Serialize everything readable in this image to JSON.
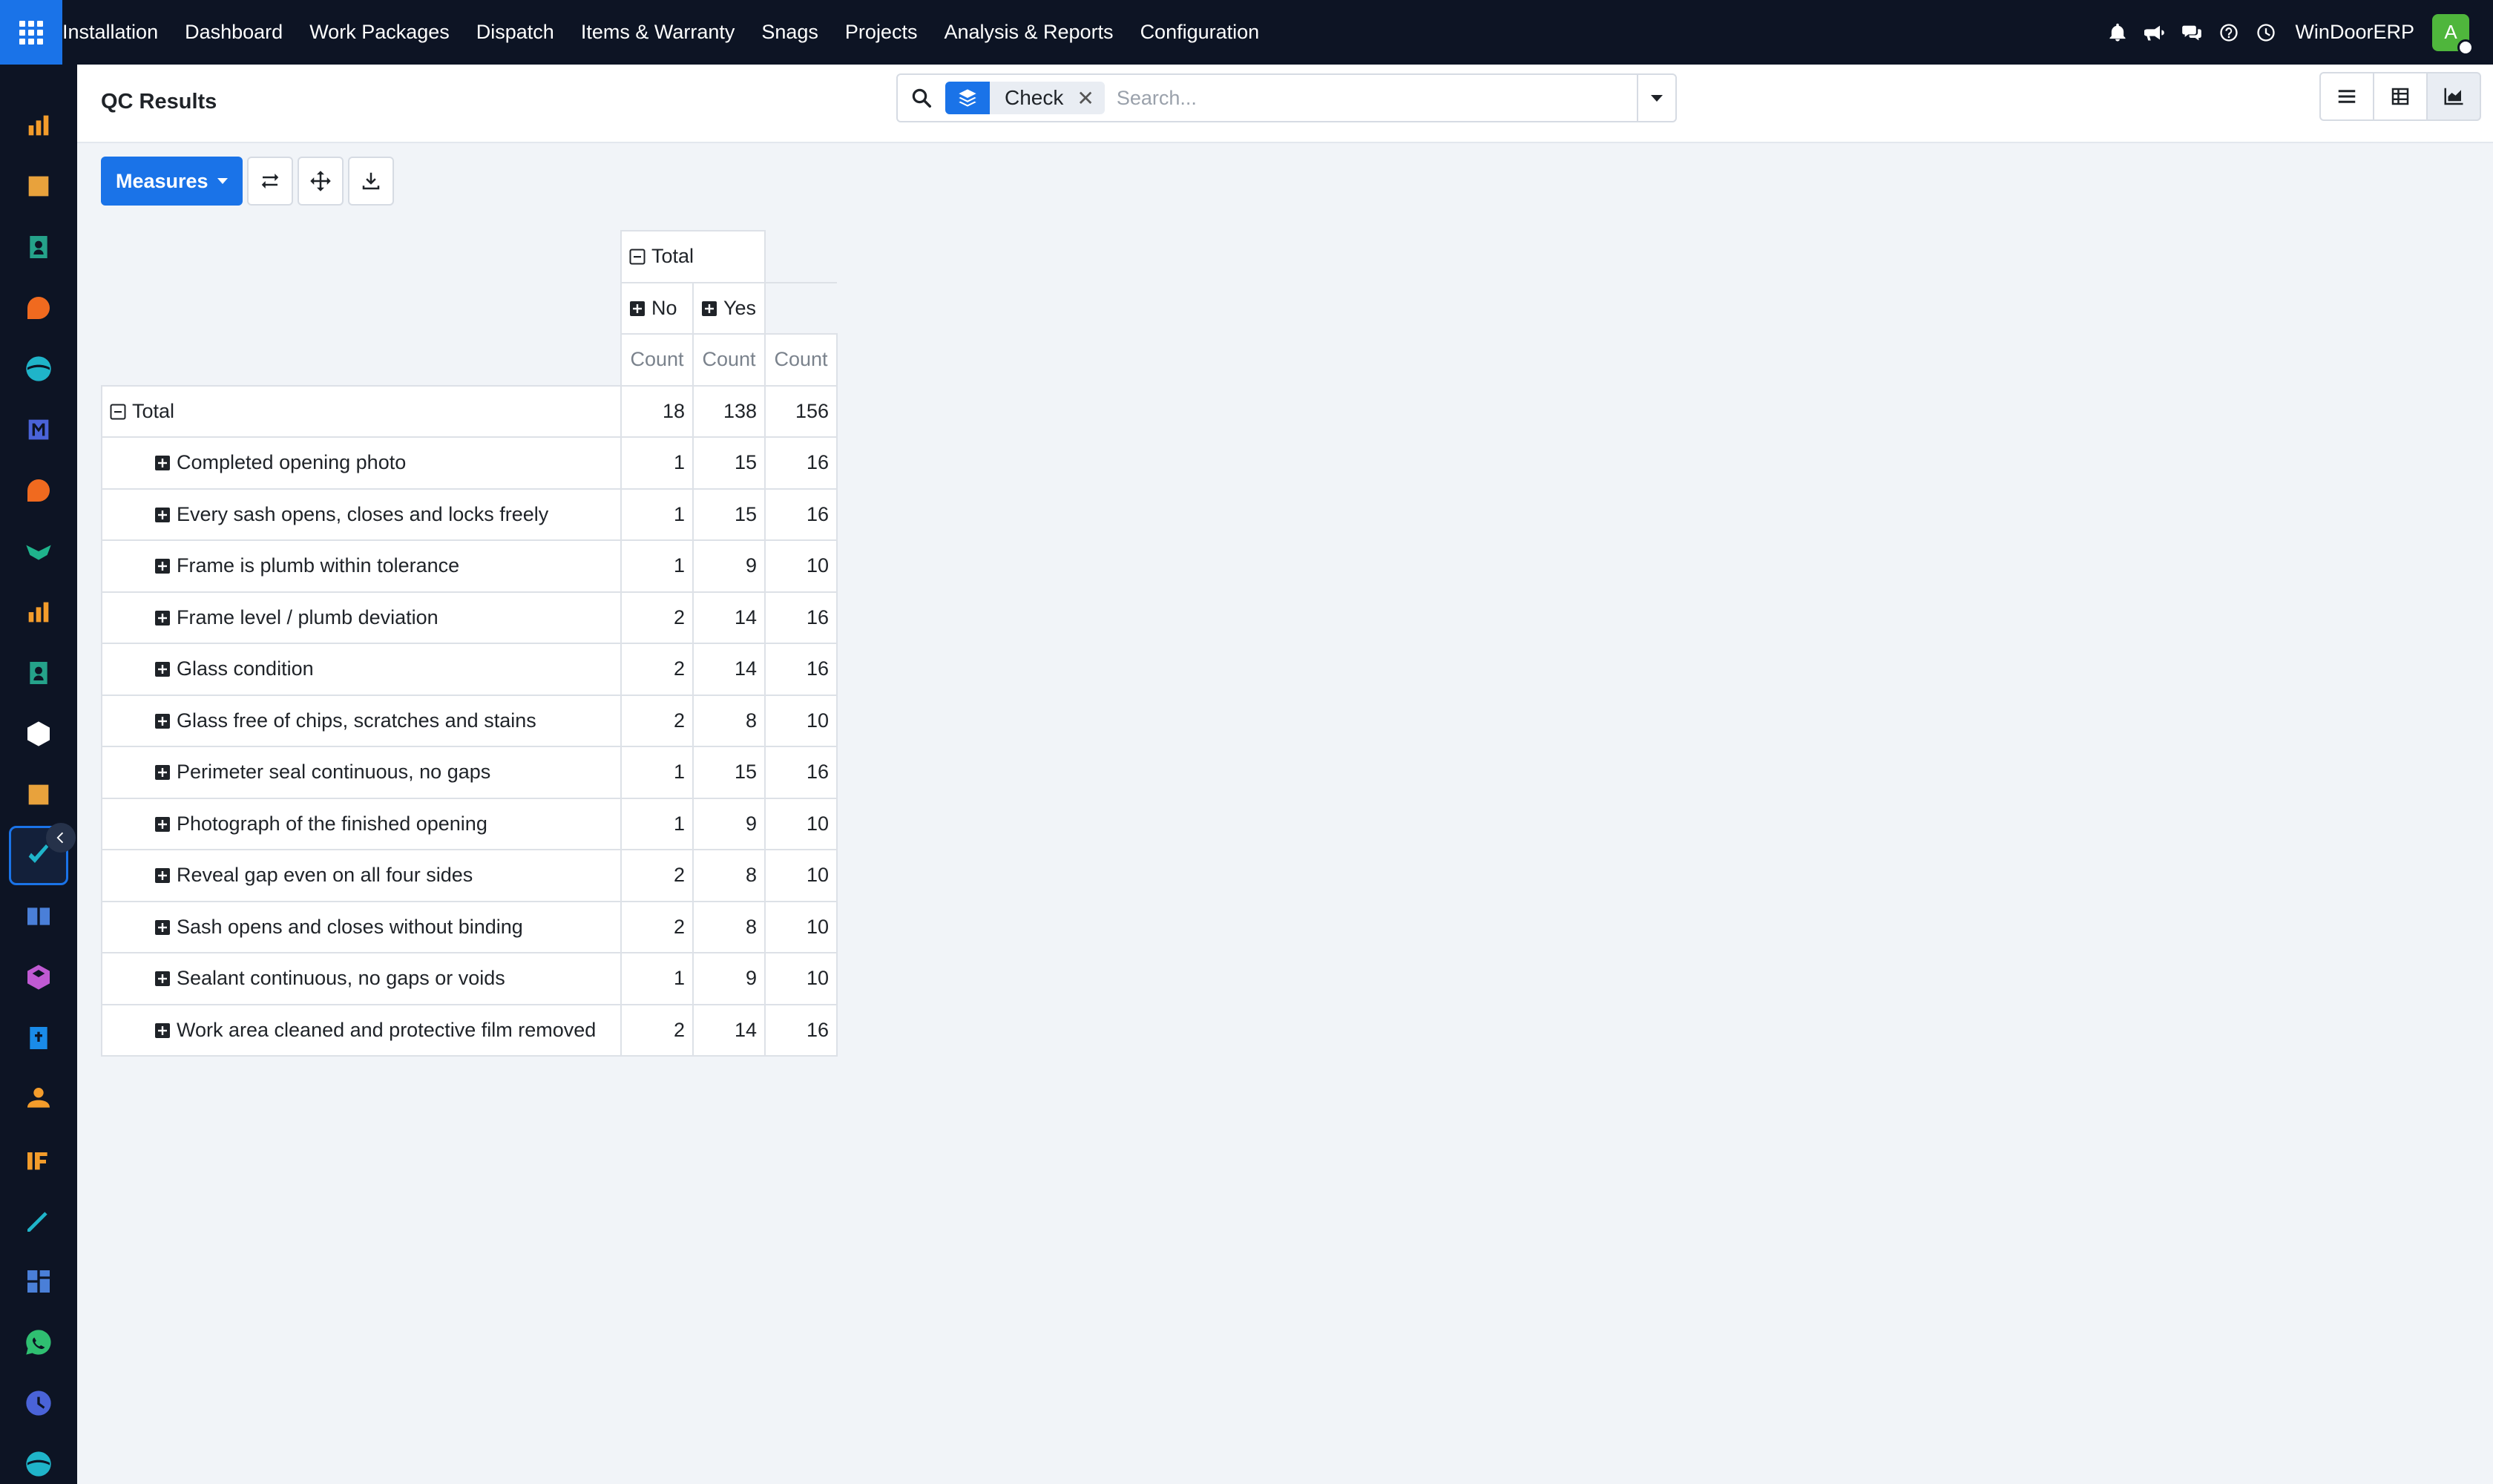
{
  "topbar": {
    "nav": [
      "Installation",
      "Dashboard",
      "Work Packages",
      "Dispatch",
      "Items & Warranty",
      "Snags",
      "Projects",
      "Analysis & Reports",
      "Configuration"
    ],
    "company": "WinDoorERP",
    "avatar_letter": "A",
    "icons": [
      "bell-icon",
      "megaphone-icon",
      "chat-icon",
      "help-icon",
      "clock-icon"
    ]
  },
  "sidebar": {
    "items": [
      {
        "name": "reports-app-icon",
        "color": "#f39c2b"
      },
      {
        "name": "field-service-app-icon",
        "color": "#e8a23c"
      },
      {
        "name": "contacts-app-icon",
        "color": "#25a28a"
      },
      {
        "name": "discuss-app-icon",
        "color": "#f06a1f"
      },
      {
        "name": "website-app-icon",
        "color": "#1fb4c9"
      },
      {
        "name": "email-marketing-app-icon",
        "color": "#4a63d8"
      },
      {
        "name": "live-chat-app-icon",
        "color": "#f06a1f"
      },
      {
        "name": "crm-app-icon",
        "color": "#1fb48c"
      },
      {
        "name": "dashboards-app-icon",
        "color": "#f39c2b"
      },
      {
        "name": "employees-app-icon",
        "color": "#25a28a"
      },
      {
        "name": "inventory-app-icon",
        "color": "#ffffff"
      },
      {
        "name": "tools-app-icon",
        "color": "#e8a23c"
      },
      {
        "name": "quality-app-icon",
        "color": "#1fb4c9",
        "active": true
      },
      {
        "name": "knowledge-app-icon",
        "color": "#4a7fd8"
      },
      {
        "name": "products-app-icon",
        "color": "#c05ad3"
      },
      {
        "name": "invoicing-app-icon",
        "color": "#1a8be8"
      },
      {
        "name": "team-app-icon",
        "color": "#f39c2b"
      },
      {
        "name": "calendar-app-icon",
        "color": "#f39c2b"
      },
      {
        "name": "sign-app-icon",
        "color": "#1fb4c9"
      },
      {
        "name": "apps-app-icon",
        "color": "#4a7fd8"
      },
      {
        "name": "whatsapp-app-icon",
        "color": "#2fbf71"
      },
      {
        "name": "timer-app-icon",
        "color": "#4a63d8"
      },
      {
        "name": "website-2-app-icon",
        "color": "#1fb4c9"
      }
    ],
    "collapse_icon": "chevron-left-icon"
  },
  "control": {
    "title": "QC Results",
    "search": {
      "facet_value": "Check",
      "facet_remove": "✕",
      "placeholder": "Search..."
    },
    "views": [
      "list-view-icon",
      "pivot-view-icon",
      "graph-view-icon"
    ],
    "active_view": "graph-view-icon"
  },
  "toolbar": {
    "measures_label": "Measures",
    "buttons": [
      "flip-axis-icon",
      "expand-all-icon",
      "download-icon"
    ]
  },
  "pivot": {
    "col_total_label": "Total",
    "col_groups": [
      "No",
      "Yes"
    ],
    "measure_label": "Count",
    "row_total_label": "Total",
    "totals": {
      "No": 18,
      "Yes": 138,
      "Total": 156
    },
    "rows": [
      {
        "label": "Completed opening photo",
        "No": 1,
        "Yes": 15,
        "Total": 16
      },
      {
        "label": "Every sash opens, closes and locks freely",
        "No": 1,
        "Yes": 15,
        "Total": 16
      },
      {
        "label": "Frame is plumb within tolerance",
        "No": 1,
        "Yes": 9,
        "Total": 10
      },
      {
        "label": "Frame level / plumb deviation",
        "No": 2,
        "Yes": 14,
        "Total": 16
      },
      {
        "label": "Glass condition",
        "No": 2,
        "Yes": 14,
        "Total": 16
      },
      {
        "label": "Glass free of chips, scratches and stains",
        "No": 2,
        "Yes": 8,
        "Total": 10
      },
      {
        "label": "Perimeter seal continuous, no gaps",
        "No": 1,
        "Yes": 15,
        "Total": 16
      },
      {
        "label": "Photograph of the finished opening",
        "No": 1,
        "Yes": 9,
        "Total": 10
      },
      {
        "label": "Reveal gap even on all four sides",
        "No": 2,
        "Yes": 8,
        "Total": 10
      },
      {
        "label": "Sash opens and closes without binding",
        "No": 2,
        "Yes": 8,
        "Total": 10
      },
      {
        "label": "Sealant continuous, no gaps or voids",
        "No": 1,
        "Yes": 9,
        "Total": 10
      },
      {
        "label": "Work area cleaned and protective film removed",
        "No": 2,
        "Yes": 14,
        "Total": 16
      }
    ]
  },
  "colors": {
    "accent": "#1a73e8",
    "topbar_bg": "#0d1424",
    "page_bg": "#f1f4f8"
  }
}
